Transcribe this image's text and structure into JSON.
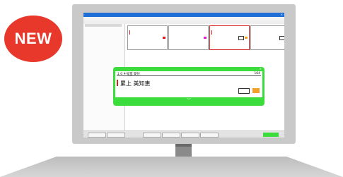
{
  "badge": {
    "label": "NEW"
  },
  "app": {
    "title": "",
    "menu": [],
    "toolbar": []
  },
  "left_panel": {},
  "cards": [],
  "popup": {
    "room_label": "１６４号室 受付",
    "count": "164",
    "kana": "",
    "name": "累上 美知恵",
    "stamp": "",
    "footer": ""
  },
  "statusbar": {
    "buttons": [],
    "green_label": ""
  },
  "colors": {
    "badge": "#e8382c",
    "popup": "#3bdc3b",
    "titlebar": "#1f6fd6",
    "red_bar": "#d81e1e",
    "orange_tag": "#f2a22a"
  }
}
